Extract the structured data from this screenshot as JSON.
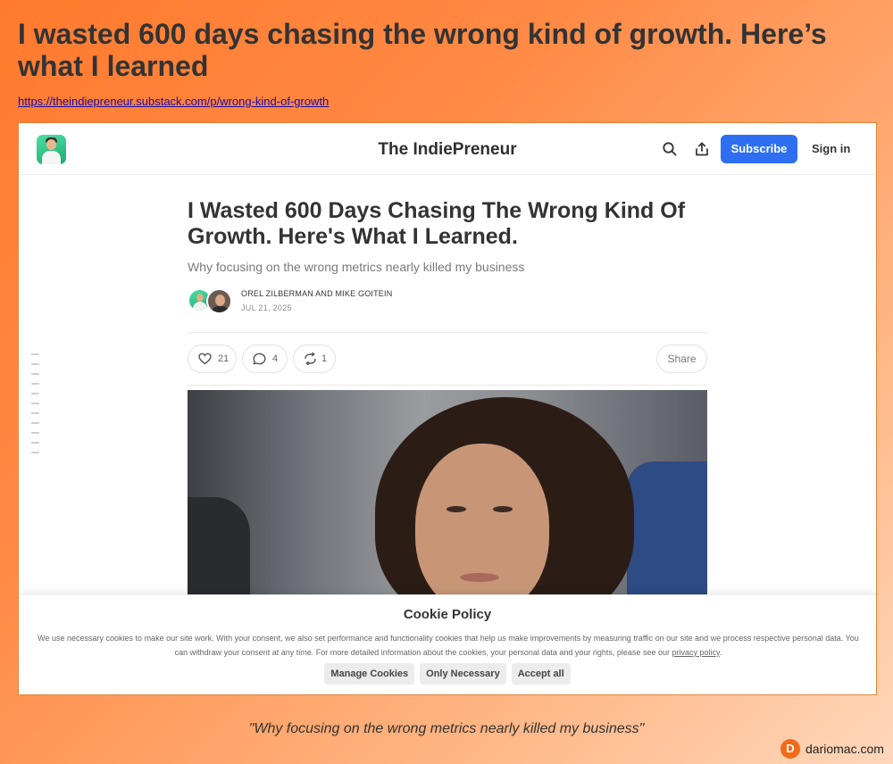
{
  "page": {
    "title": "I wasted 600 days chasing the wrong kind of growth. Here’s what I learned",
    "url": "https://theindiepreneur.substack.com/p/wrong-kind-of-growth",
    "caption": "\"Why focusing on the wrong metrics nearly killed my business\""
  },
  "navbar": {
    "brand": "The IndiePreneur",
    "subscribe_label": "Subscribe",
    "signin_label": "Sign in",
    "icons": [
      "logo-avatar",
      "search-icon",
      "share-icon"
    ],
    "subscribe_color": "#2d6ff0"
  },
  "article": {
    "title": "I Wasted 600 Days Chasing The Wrong Kind Of Growth. Here's What I Learned.",
    "subtitle": "Why focusing on the wrong metrics nearly killed my business",
    "authors": "OREL ZILBERMAN AND MIKE GOITEIN",
    "date": "JUL 21, 2025",
    "likes": "21",
    "comments": "4",
    "restacks": "1",
    "share_label": "Share"
  },
  "cookie": {
    "title": "Cookie Policy",
    "text": "We use necessary cookies to make our site work. With your consent, we also set performance and functionality cookies that help us make improvements by measuring traffic on our site and we process respective personal data. You can withdraw your consent at any time. For more detailed information about the cookies, your personal data and your rights, please see our ",
    "link": "privacy policy",
    "link_suffix": ".",
    "buttons": {
      "manage": "Manage Cookies",
      "necessary": "Only Necessary",
      "accept": "Accept all"
    }
  },
  "watermark": {
    "logo_letter": "D",
    "text": "dariomac.com",
    "color": "#f26a1b"
  }
}
